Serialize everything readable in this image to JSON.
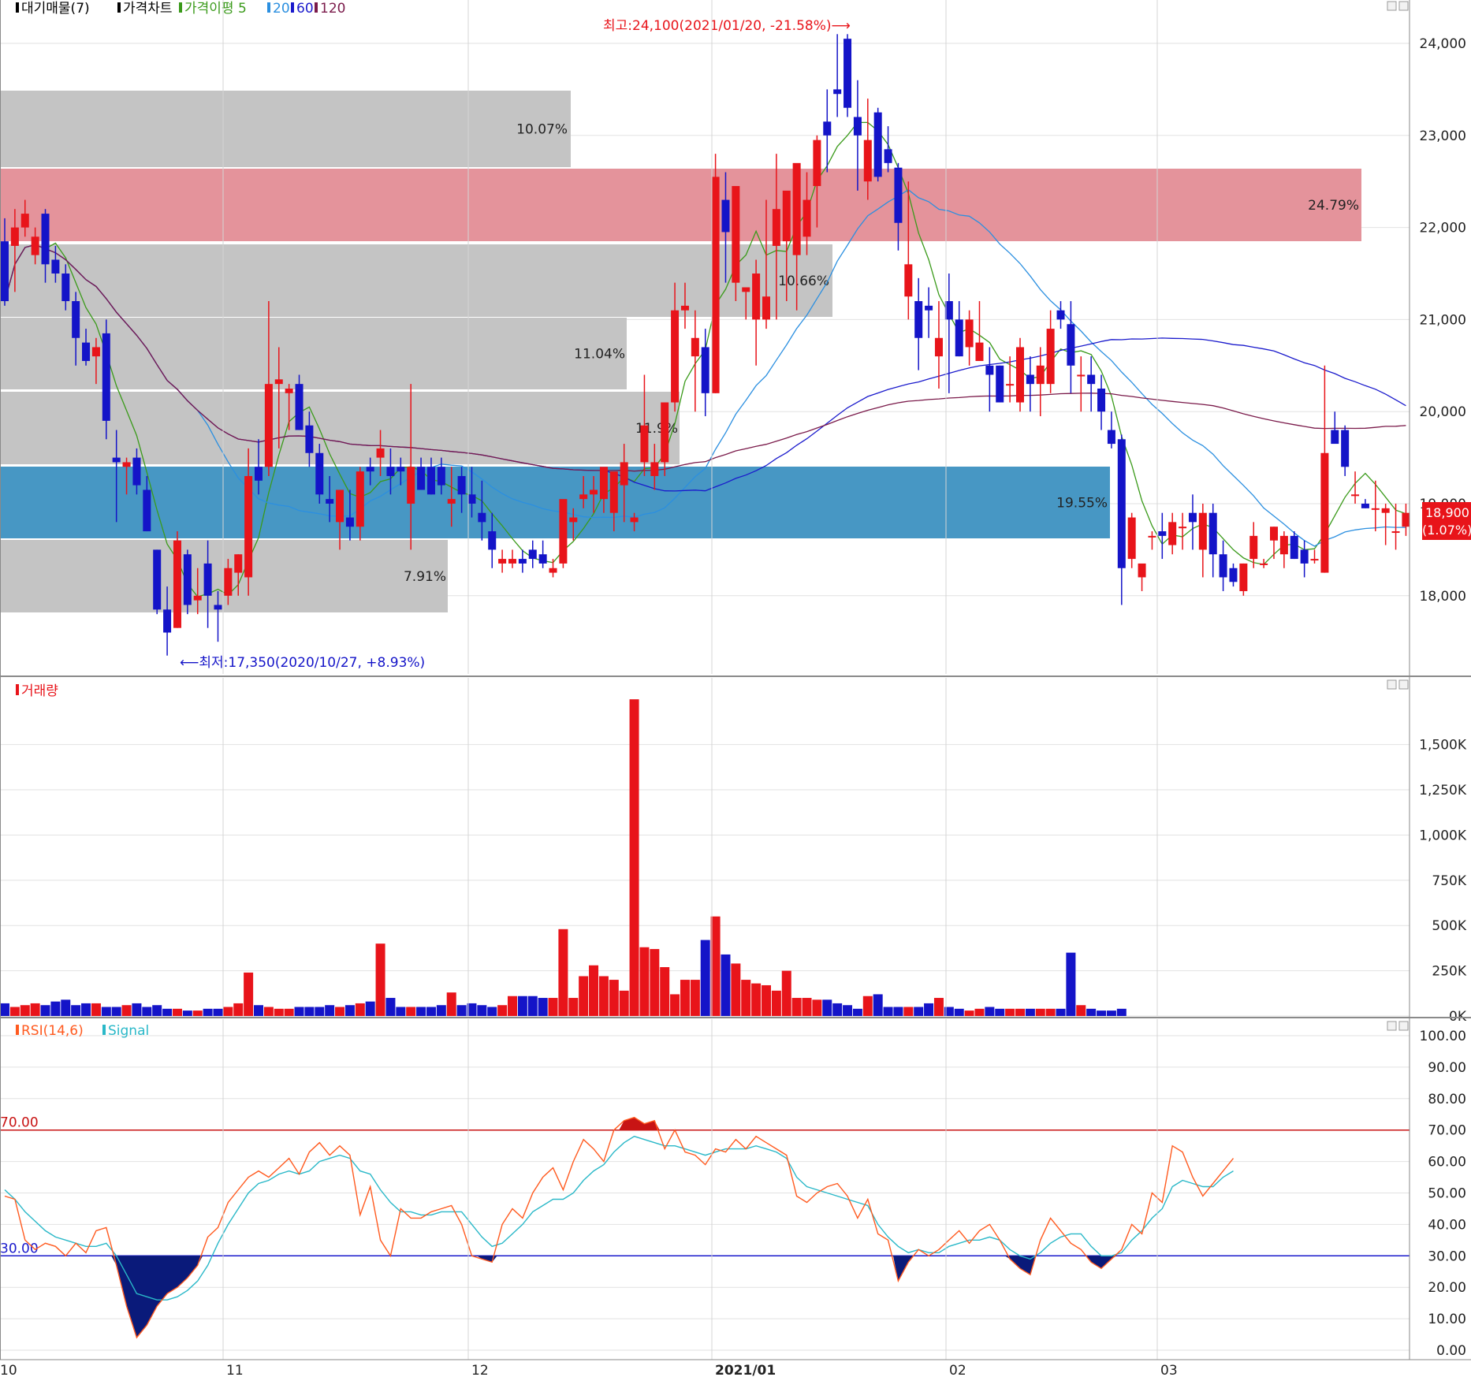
{
  "legend": {
    "price_items": [
      {
        "label": "대기매물(7)",
        "color": "#000000"
      },
      {
        "label": "가격차트",
        "color": "#000000"
      },
      {
        "label": "가격이평 5",
        "color": "#3a9a1a"
      },
      {
        "label": "20",
        "color": "#2b8fe0"
      },
      {
        "label": "60",
        "color": "#1a1acc"
      },
      {
        "label": "120",
        "color": "#7a1a4a"
      }
    ],
    "volume_label": "거래량",
    "rsi_items": [
      {
        "label": "RSI(14,6)",
        "color": "#ff5a1f"
      },
      {
        "label": "Signal",
        "color": "#2ab8c8"
      }
    ]
  },
  "annotations": {
    "high": "최고:24,100(2021/01/20, -21.58%)⟶",
    "low": "⟵최저:17,350(2020/10/27, +8.93%)"
  },
  "current_price": {
    "value": "18,900",
    "change": "(1.07%)"
  },
  "colors": {
    "up": "#e8141a",
    "down": "#1414c8",
    "ma5": "#3a9a1a",
    "ma20": "#2b8fe0",
    "ma60": "#1a1acc",
    "ma120": "#7a1a4a",
    "rsi": "#ff5a1f",
    "signal": "#2ab8c8",
    "zone_grey": "#c4c4c4",
    "zone_pink": "#e4939b",
    "zone_blue": "#4797c4"
  },
  "chart_data": {
    "price": {
      "type": "candlestick",
      "yaxis_ticks": [
        "24,000",
        "23,000",
        "22,000",
        "21,000",
        "20,000",
        "19,000",
        "18,000"
      ],
      "ylim": [
        17300,
        24100
      ],
      "xaxis_ticks": [
        "10",
        "11",
        "12",
        "2021/01",
        "02",
        "03"
      ],
      "candles": [
        [
          21850,
          22100,
          21150,
          21200
        ],
        [
          21800,
          22200,
          21300,
          22000
        ],
        [
          22000,
          22300,
          21900,
          22150
        ],
        [
          21700,
          22000,
          21600,
          21900
        ],
        [
          22150,
          22200,
          21400,
          21600
        ],
        [
          21650,
          21800,
          21400,
          21500
        ],
        [
          21500,
          21600,
          21100,
          21200
        ],
        [
          21200,
          21300,
          20500,
          20800
        ],
        [
          20750,
          20900,
          20500,
          20550
        ],
        [
          20600,
          20800,
          20300,
          20700
        ],
        [
          20850,
          21000,
          19700,
          19900
        ],
        [
          19500,
          19800,
          18800,
          19450
        ],
        [
          19400,
          19500,
          19100,
          19450
        ],
        [
          19500,
          19600,
          19100,
          19200
        ],
        [
          19150,
          19300,
          18700,
          18700
        ],
        [
          18500,
          18500,
          17800,
          17850
        ],
        [
          17850,
          18100,
          17350,
          17600
        ],
        [
          17650,
          18700,
          17650,
          18600
        ],
        [
          18450,
          18500,
          17800,
          17900
        ],
        [
          17950,
          18300,
          17800,
          18000
        ],
        [
          18350,
          18600,
          17650,
          18000
        ],
        [
          17900,
          18050,
          17500,
          17850
        ],
        [
          18000,
          18400,
          17900,
          18300
        ],
        [
          18250,
          18450,
          18000,
          18450
        ],
        [
          18200,
          19600,
          18000,
          19300
        ],
        [
          19400,
          19700,
          19100,
          19250
        ],
        [
          19400,
          21200,
          19300,
          20300
        ],
        [
          20300,
          20700,
          19600,
          20350
        ],
        [
          20200,
          20300,
          19800,
          20250
        ],
        [
          20300,
          20400,
          19800,
          19800
        ],
        [
          19850,
          20000,
          19400,
          19550
        ],
        [
          19550,
          19650,
          19000,
          19100
        ],
        [
          19050,
          19300,
          18800,
          19000
        ],
        [
          18800,
          19100,
          18500,
          19150
        ],
        [
          18850,
          19150,
          18600,
          18750
        ],
        [
          18750,
          19400,
          18600,
          19350
        ],
        [
          19400,
          19500,
          19200,
          19350
        ],
        [
          19500,
          19800,
          19300,
          19600
        ],
        [
          19400,
          19600,
          19100,
          19300
        ],
        [
          19400,
          19500,
          19200,
          19350
        ],
        [
          19000,
          20300,
          18500,
          19400
        ],
        [
          19400,
          19500,
          19150,
          19150
        ],
        [
          19400,
          19500,
          19100,
          19100
        ],
        [
          19400,
          19500,
          19100,
          19200
        ],
        [
          19000,
          19400,
          18750,
          19050
        ],
        [
          19300,
          19400,
          18900,
          19100
        ],
        [
          19100,
          19400,
          18850,
          19000
        ],
        [
          18900,
          19250,
          18600,
          18800
        ],
        [
          18700,
          18900,
          18300,
          18500
        ],
        [
          18350,
          18500,
          18250,
          18400
        ],
        [
          18350,
          18500,
          18300,
          18400
        ],
        [
          18400,
          18500,
          18250,
          18350
        ],
        [
          18500,
          18600,
          18300,
          18400
        ],
        [
          18450,
          18600,
          18300,
          18350
        ],
        [
          18250,
          18400,
          18200,
          18300
        ],
        [
          18350,
          19000,
          18300,
          19050
        ],
        [
          18800,
          18950,
          18600,
          18850
        ],
        [
          19050,
          19300,
          18950,
          19100
        ],
        [
          19100,
          19300,
          18900,
          19150
        ],
        [
          19050,
          19350,
          18900,
          19400
        ],
        [
          18900,
          19300,
          18700,
          19350
        ],
        [
          19200,
          19650,
          18800,
          19450
        ],
        [
          18800,
          18900,
          18700,
          18850
        ],
        [
          19450,
          20400,
          19300,
          19850
        ],
        [
          19300,
          19650,
          19150,
          19450
        ],
        [
          19450,
          20100,
          19300,
          20100
        ],
        [
          20100,
          21400,
          20000,
          21100
        ],
        [
          21100,
          21400,
          20900,
          21150
        ],
        [
          20600,
          21100,
          20000,
          20800
        ],
        [
          20700,
          20900,
          19950,
          20200
        ],
        [
          20200,
          22800,
          20200,
          22550
        ],
        [
          22300,
          22600,
          21400,
          21950
        ],
        [
          21400,
          22400,
          21200,
          22450
        ],
        [
          21300,
          21300,
          21000,
          21350
        ],
        [
          21000,
          21650,
          20500,
          21500
        ],
        [
          21000,
          22300,
          20900,
          21250
        ],
        [
          21800,
          22800,
          21000,
          22200
        ],
        [
          21850,
          22200,
          21200,
          22400
        ],
        [
          21700,
          22500,
          21100,
          22700
        ],
        [
          21900,
          22600,
          21700,
          22300
        ],
        [
          22450,
          23000,
          22000,
          22950
        ],
        [
          23150,
          23500,
          22600,
          23000
        ],
        [
          23500,
          24100,
          23200,
          23450
        ],
        [
          24050,
          24100,
          23200,
          23300
        ],
        [
          23200,
          23600,
          22400,
          23000
        ],
        [
          22500,
          23400,
          22300,
          22950
        ],
        [
          23250,
          23300,
          22500,
          22550
        ],
        [
          22850,
          23100,
          22600,
          22700
        ],
        [
          22650,
          22700,
          21750,
          22050
        ],
        [
          21250,
          22500,
          21000,
          21600
        ],
        [
          21200,
          21450,
          20450,
          20800
        ],
        [
          21150,
          21350,
          20800,
          21100
        ],
        [
          20600,
          21200,
          20250,
          20800
        ],
        [
          21200,
          21500,
          20200,
          21000
        ],
        [
          21000,
          21200,
          20600,
          20600
        ],
        [
          20700,
          21100,
          20500,
          21000
        ],
        [
          20550,
          21200,
          20700,
          20750
        ],
        [
          20500,
          20700,
          20000,
          20400
        ],
        [
          20500,
          20500,
          20100,
          20100
        ],
        [
          20300,
          20600,
          20100,
          20300
        ],
        [
          20100,
          20800,
          20000,
          20700
        ],
        [
          20400,
          20600,
          20000,
          20300
        ],
        [
          20300,
          20700,
          19950,
          20500
        ],
        [
          20300,
          21100,
          20200,
          20900
        ],
        [
          21100,
          21200,
          20900,
          21000
        ],
        [
          20950,
          21200,
          20200,
          20500
        ],
        [
          20400,
          20600,
          20000,
          20400
        ],
        [
          20400,
          20600,
          20000,
          20300
        ],
        [
          20250,
          20400,
          19800,
          20000
        ],
        [
          19800,
          20000,
          19600,
          19650
        ],
        [
          19700,
          19750,
          17900,
          18300
        ],
        [
          18400,
          18900,
          18300,
          18850
        ],
        [
          18200,
          18300,
          18050,
          18350
        ],
        [
          18650,
          18700,
          18500,
          18650
        ],
        [
          18700,
          18900,
          18400,
          18650
        ],
        [
          18550,
          18900,
          18450,
          18800
        ],
        [
          18750,
          18900,
          18500,
          18750
        ],
        [
          18900,
          19100,
          18500,
          18800
        ],
        [
          18500,
          19000,
          18200,
          18900
        ],
        [
          18900,
          19000,
          18200,
          18450
        ],
        [
          18450,
          18600,
          18050,
          18200
        ],
        [
          18300,
          18350,
          18100,
          18150
        ],
        [
          18050,
          18350,
          18000,
          18350
        ],
        [
          18400,
          18800,
          18300,
          18650
        ],
        [
          18350,
          18400,
          18300,
          18350
        ],
        [
          18600,
          18750,
          18400,
          18750
        ],
        [
          18450,
          18700,
          18300,
          18650
        ],
        [
          18650,
          18700,
          18400,
          18400
        ],
        [
          18500,
          18600,
          18200,
          18350
        ],
        [
          18400,
          18500,
          18350,
          18400
        ],
        [
          18250,
          20500,
          18250,
          19550
        ],
        [
          19800,
          20000,
          19700,
          19650
        ],
        [
          19800,
          19850,
          19300,
          19400
        ],
        [
          19100,
          19350,
          19000,
          19100
        ],
        [
          19000,
          19050,
          18950,
          18950
        ],
        [
          18950,
          19250,
          18700,
          18950
        ],
        [
          18900,
          19000,
          18550,
          18950
        ],
        [
          18700,
          19000,
          18500,
          18700
        ],
        [
          18750,
          19000,
          18650,
          18900
        ]
      ]
    },
    "volume": {
      "type": "bar",
      "yaxis_ticks": [
        "1,500K",
        "1,250K",
        "1,000K",
        "750K",
        "500K",
        "250K",
        "0K"
      ],
      "ylim": [
        0,
        1750
      ],
      "values": [
        70,
        50,
        60,
        70,
        60,
        80,
        90,
        60,
        70,
        70,
        50,
        50,
        60,
        70,
        50,
        60,
        40,
        40,
        30,
        30,
        40,
        40,
        50,
        70,
        240,
        60,
        50,
        40,
        40,
        50,
        50,
        50,
        60,
        50,
        60,
        70,
        80,
        400,
        100,
        50,
        50,
        50,
        50,
        60,
        130,
        60,
        70,
        60,
        50,
        60,
        110,
        110,
        110,
        100,
        100,
        480,
        100,
        220,
        280,
        220,
        200,
        140,
        1750,
        380,
        370,
        270,
        120,
        200,
        200,
        420,
        550,
        340,
        290,
        200,
        180,
        170,
        140,
        250,
        100,
        100,
        90,
        90,
        70,
        60,
        40,
        110,
        120,
        50,
        50,
        50,
        50,
        70,
        100,
        50,
        40,
        30,
        40,
        50,
        40,
        40,
        40,
        40,
        40,
        40,
        40,
        350,
        60,
        40,
        30,
        30,
        40
      ]
    },
    "rsi": {
      "type": "line",
      "yaxis_ticks": [
        "100.00",
        "90.00",
        "80.00",
        "70.00",
        "60.00",
        "50.00",
        "40.00",
        "30.00",
        "20.00",
        "10.00",
        "0.00"
      ],
      "ylim": [
        0,
        100
      ],
      "levels": [
        {
          "label": "70.00",
          "value": 70
        },
        {
          "label": "30.00",
          "value": 30
        }
      ],
      "series": [
        {
          "name": "RSI(14,6)",
          "values": [
            49,
            48,
            35,
            32,
            34,
            33,
            30,
            34,
            31,
            38,
            39,
            27,
            14,
            4,
            8,
            14,
            18,
            20,
            23,
            27,
            36,
            39,
            47,
            51,
            55,
            57,
            55,
            58,
            61,
            56,
            63,
            66,
            62,
            65,
            62,
            43,
            52,
            35,
            30,
            45,
            42,
            42,
            44,
            45,
            46,
            40,
            30,
            29,
            28,
            40,
            45,
            42,
            50,
            55,
            58,
            51,
            60,
            67,
            64,
            60,
            70,
            73,
            74,
            72,
            73,
            64,
            70,
            63,
            62,
            59,
            64,
            63,
            67,
            64,
            68,
            66,
            64,
            62,
            49,
            47,
            50,
            52,
            53,
            49,
            42,
            48,
            37,
            35,
            22,
            28,
            32,
            30,
            32,
            35,
            38,
            34,
            38,
            40,
            35,
            29,
            26,
            24,
            35,
            42,
            38,
            34,
            32,
            28,
            26,
            29,
            32,
            40,
            37,
            50,
            47,
            65,
            63,
            55,
            49,
            53,
            57,
            61
          ]
        },
        {
          "name": "Signal",
          "values": [
            51,
            48,
            44,
            41,
            38,
            36,
            35,
            34,
            33,
            33,
            34,
            30,
            24,
            18,
            17,
            16,
            16,
            17,
            19,
            22,
            27,
            34,
            40,
            45,
            50,
            53,
            54,
            56,
            57,
            56,
            57,
            60,
            61,
            62,
            61,
            57,
            56,
            51,
            47,
            44,
            44,
            43,
            43,
            44,
            44,
            44,
            40,
            36,
            33,
            34,
            37,
            40,
            44,
            46,
            48,
            48,
            50,
            54,
            57,
            59,
            63,
            66,
            68,
            67,
            66,
            65,
            65,
            64,
            63,
            62,
            63,
            64,
            64,
            64,
            65,
            64,
            63,
            61,
            55,
            52,
            51,
            50,
            49,
            48,
            47,
            46,
            40,
            36,
            33,
            31,
            32,
            31,
            31,
            33,
            34,
            35,
            35,
            36,
            35,
            32,
            30,
            29,
            31,
            34,
            36,
            37,
            37,
            33,
            30,
            30,
            31,
            35,
            38,
            42,
            45,
            52,
            54,
            53,
            52,
            52,
            55,
            57
          ]
        }
      ]
    }
  }
}
